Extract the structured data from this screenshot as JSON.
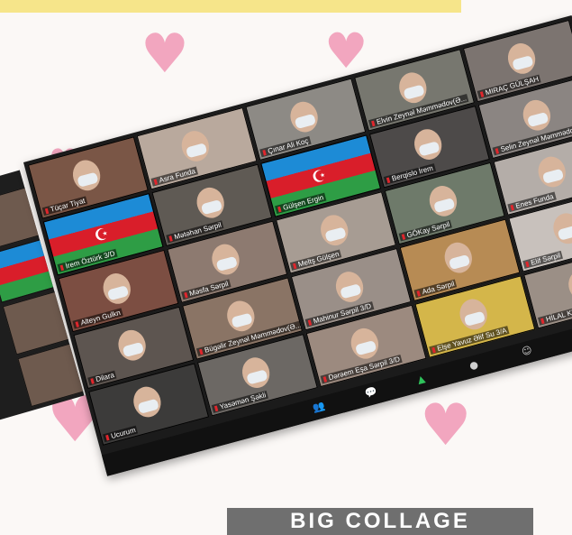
{
  "participants": [
    {
      "name": "Tüçar Tiyat",
      "bg": "#7a5646"
    },
    {
      "name": "Asra Funda",
      "bg": "#b9a99d"
    },
    {
      "name": "Çınar Ali Koç",
      "bg": "#8d8a85"
    },
    {
      "name": "Elvin Zeynəl Məmmədov(Ə...",
      "bg": "#77776f"
    },
    {
      "name": "MIRAÇ GÜLŞAH",
      "bg": "#7c7470"
    },
    {
      "name": "İrem Öztürk 3/D",
      "bg": "#2773a8",
      "flag": true
    },
    {
      "name": "Mətəhan Sərpil",
      "bg": "#5f5a54"
    },
    {
      "name": "Gülşen Ergin",
      "bg": "#2b78c2",
      "flag": true
    },
    {
      "name": "Berqislo İrem",
      "bg": "#4d4a49"
    },
    {
      "name": "Selin Zeynəl Məmmədova(Ə...",
      "bg": "#8b8582"
    },
    {
      "name": "Alteyn Gulkn",
      "bg": "#7c4e42"
    },
    {
      "name": "Məsfa Sərpil",
      "bg": "#8d7a70"
    },
    {
      "name": "Meltş Gülşen",
      "bg": "#a79c93"
    },
    {
      "name": "GÖKay Sərpil",
      "bg": "#6e7a6a"
    },
    {
      "name": "Enes Funda",
      "bg": "#b4ada8"
    },
    {
      "name": "Dilara",
      "bg": "#5d5550"
    },
    {
      "name": "Bügəlir Zeynəl Məmmədov(Ə...",
      "bg": "#8a7465"
    },
    {
      "name": "Mahinur Sərpil 3/D",
      "bg": "#9a8f88"
    },
    {
      "name": "Ada Sərpil",
      "bg": "#b78b54"
    },
    {
      "name": "Elif Sərpil",
      "bg": "#c8c1bc"
    },
    {
      "name": "Ucurum",
      "bg": "#3c3b3a"
    },
    {
      "name": "Yasəmən Şəkli",
      "bg": "#6c6864"
    },
    {
      "name": "Dərəem Eşa Sərpil 3/D",
      "bg": "#9c8a7f"
    },
    {
      "name": "Elşe Yavuz Əlif Su 3/A",
      "bg": "#d4b64a"
    },
    {
      "name": "HİLAL KÜÇÜKLER ÇERECİ",
      "bg": "#9b8f86"
    }
  ],
  "banner": {
    "bottom_text": "BIG COLLAGE"
  },
  "colors": {
    "heart": "#f2a6bf",
    "top_banner": "#f6e58a"
  }
}
